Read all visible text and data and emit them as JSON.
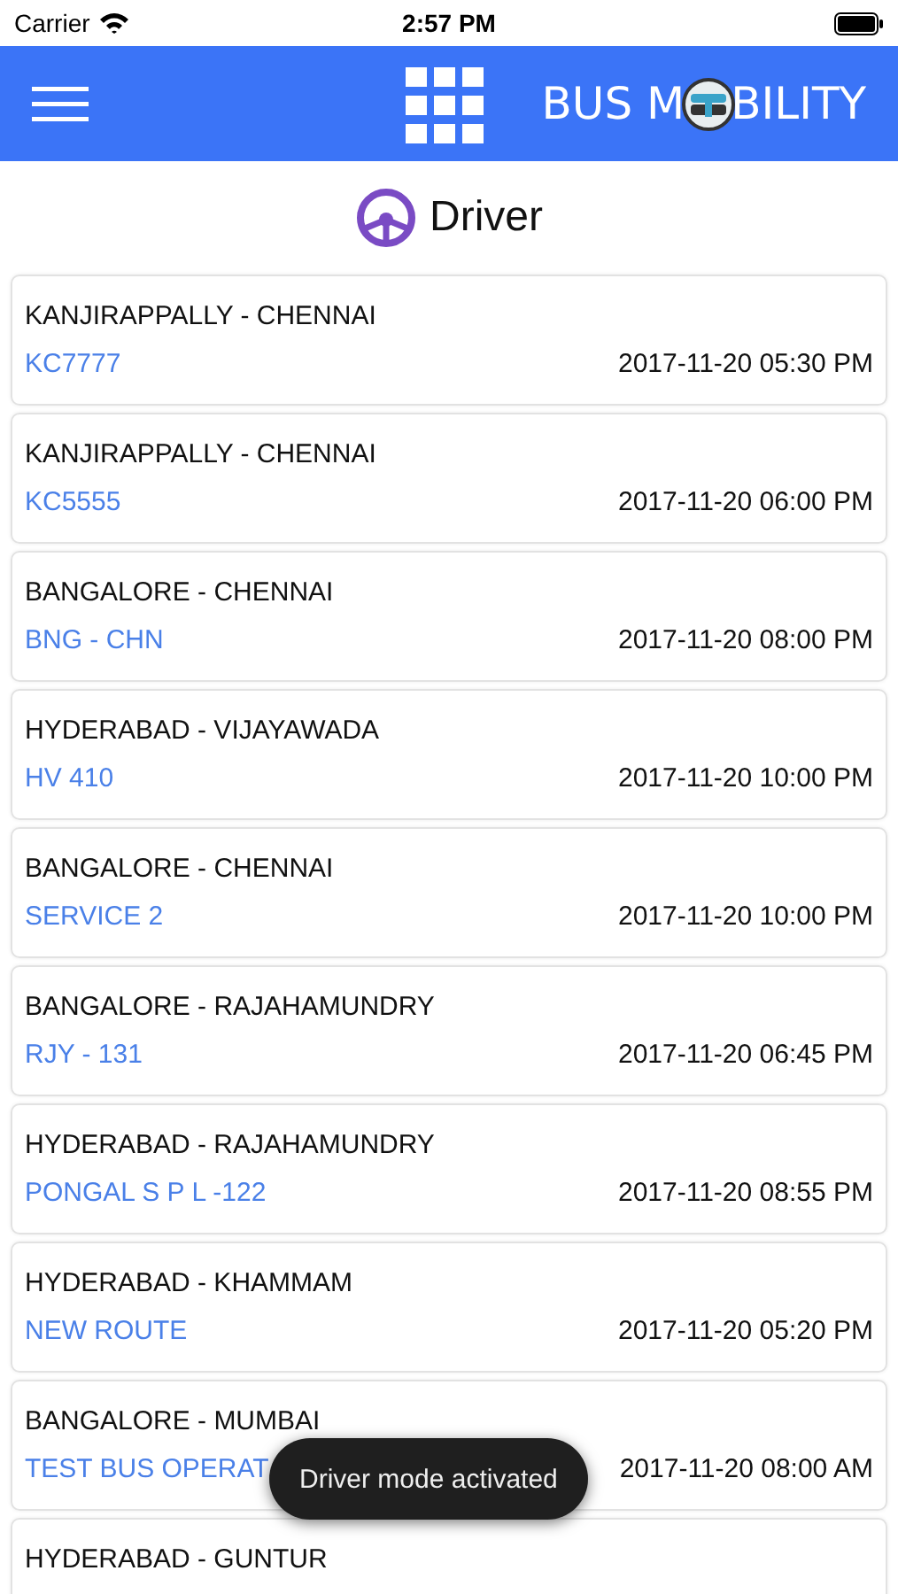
{
  "status_bar": {
    "carrier": "Carrier",
    "time": "2:57 PM"
  },
  "header": {
    "logo_left": "BUS M",
    "logo_right": "BILITY"
  },
  "page_title": "Driver",
  "trips": [
    {
      "route": "KANJIRAPPALLY - CHENNAI",
      "service": "KC7777",
      "departure": "2017-11-20 05:30 PM"
    },
    {
      "route": "KANJIRAPPALLY - CHENNAI",
      "service": "KC5555",
      "departure": "2017-11-20 06:00 PM"
    },
    {
      "route": "BANGALORE - CHENNAI",
      "service": "BNG - CHN",
      "departure": "2017-11-20 08:00 PM"
    },
    {
      "route": "HYDERABAD - VIJAYAWADA",
      "service": "HV 410",
      "departure": "2017-11-20 10:00 PM"
    },
    {
      "route": "BANGALORE - CHENNAI",
      "service": "SERVICE 2",
      "departure": "2017-11-20 10:00 PM"
    },
    {
      "route": "BANGALORE - RAJAHAMUNDRY",
      "service": "RJY - 131",
      "departure": "2017-11-20 06:45 PM"
    },
    {
      "route": "HYDERABAD - RAJAHAMUNDRY",
      "service": "PONGAL S P L -122",
      "departure": "2017-11-20 08:55 PM"
    },
    {
      "route": "HYDERABAD - KHAMMAM",
      "service": "NEW ROUTE",
      "departure": "2017-11-20 05:20 PM"
    },
    {
      "route": "BANGALORE - MUMBAI",
      "service": "TEST BUS OPERAT",
      "departure": "2017-11-20 08:00 AM"
    },
    {
      "route": "HYDERABAD - GUNTUR"
    }
  ],
  "toast": "Driver mode activated"
}
